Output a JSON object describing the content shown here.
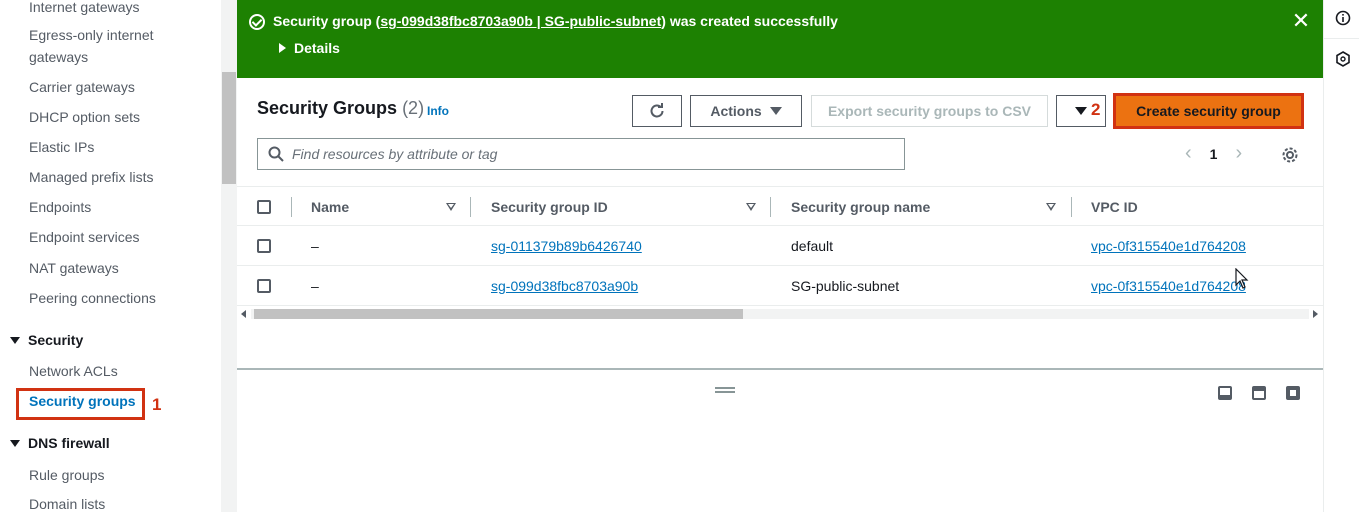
{
  "nav": {
    "items_top": [
      "Internet gateways",
      "Egress-only internet gateways",
      "Carrier gateways",
      "DHCP option sets",
      "Elastic IPs",
      "Managed prefix lists",
      "Endpoints",
      "Endpoint services",
      "NAT gateways",
      "Peering connections"
    ],
    "security_section": "Security",
    "security_items": [
      "Network ACLs",
      "Security groups"
    ],
    "dns_section": "DNS firewall",
    "dns_items": [
      "Rule groups",
      "Domain lists"
    ]
  },
  "callouts": {
    "one": "1",
    "two": "2"
  },
  "flash": {
    "prefix": "Security group (",
    "link_text": "sg-099d38fbc8703a90b | SG-public-subnet",
    "suffix": ") was created successfully",
    "details": "Details",
    "close": "✕"
  },
  "header": {
    "title": "Security Groups",
    "count": "(2)",
    "info": "Info",
    "actions_label": "Actions",
    "export_label": "Export security groups to CSV",
    "create_label": "Create security group"
  },
  "search": {
    "placeholder": "Find resources by attribute or tag"
  },
  "pagination": {
    "page": "1",
    "prev": "‹",
    "next": "›"
  },
  "table": {
    "columns": [
      "Name",
      "Security group ID",
      "Security group name",
      "VPC ID"
    ],
    "rows": [
      {
        "name": "–",
        "id": "sg-011379b89b6426740",
        "group_name": "default",
        "vpc": "vpc-0f315540e1d764208"
      },
      {
        "name": "–",
        "id": "sg-099d38fbc8703a90b",
        "group_name": "SG-public-subnet",
        "vpc": "vpc-0f315540e1d764208"
      }
    ]
  },
  "colors": {
    "success": "#1d8102",
    "primary": "#ec7211",
    "link": "#0073bb",
    "callout": "#d13212"
  }
}
